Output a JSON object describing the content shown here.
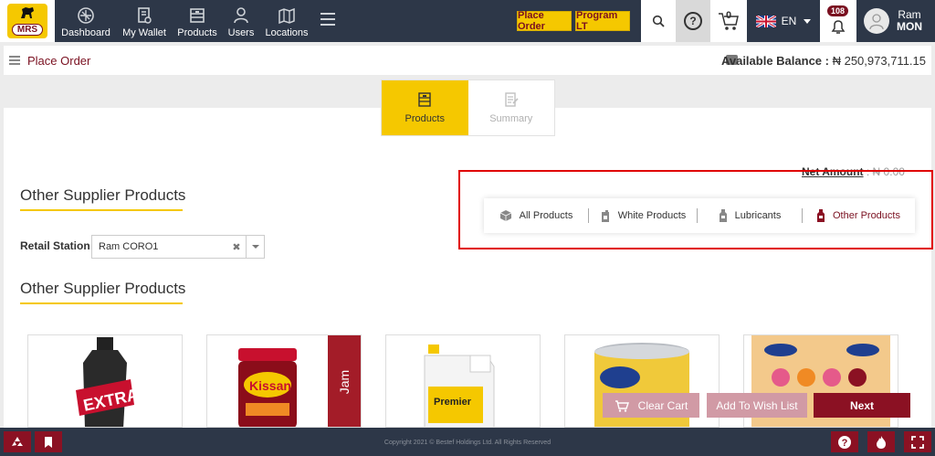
{
  "brand": {
    "logo_text": "MRS"
  },
  "nav": [
    {
      "label": "Dashboard",
      "icon": "dashboard-icon"
    },
    {
      "label": "My Wallet",
      "icon": "wallet-icon"
    },
    {
      "label": "Products",
      "icon": "products-icon"
    },
    {
      "label": "Users",
      "icon": "users-icon"
    },
    {
      "label": "Locations",
      "icon": "locations-icon"
    }
  ],
  "header": {
    "place_order": "Place Order",
    "program_lt": "Program LT",
    "cart_count": "0",
    "language": "EN",
    "notification_count": "108",
    "user_name": "Ram",
    "user_code": "MON"
  },
  "breadcrumb": {
    "title": "Place Order",
    "balance_label": "Available Balance :",
    "balance_value": "₦ 250,973,711.15"
  },
  "tabs": [
    {
      "label": "Products",
      "active": true
    },
    {
      "label": "Summary",
      "active": false
    }
  ],
  "filters": {
    "net_amount_label": "Net Amount",
    "net_amount_value": ": ₦ 0.00",
    "items": [
      {
        "label": "All Products",
        "selected": false
      },
      {
        "label": "White Products",
        "selected": false
      },
      {
        "label": "Lubricants",
        "selected": false
      },
      {
        "label": "Other Products",
        "selected": true
      }
    ]
  },
  "section": {
    "title_top": "Other Supplier Products",
    "title_bottom": "Other Supplier Products",
    "retail_label": "Retail Station",
    "retail_value": "Ram CORO1"
  },
  "products": [
    {
      "kind": "oil-bottle",
      "ribbon": ""
    },
    {
      "kind": "jam-jar",
      "ribbon": "Jam"
    },
    {
      "kind": "lubricant-jug",
      "ribbon": ""
    },
    {
      "kind": "formula-tin",
      "ribbon": ""
    },
    {
      "kind": "formula-box",
      "ribbon": ""
    }
  ],
  "actions": {
    "clear_cart": "Clear Cart",
    "wish_list": "Add To Wish List",
    "next": "Next"
  },
  "footer": {
    "copyright": "Copyright 2021 © Bestef Holdings Ltd. All Rights Reserved"
  },
  "colors": {
    "nav_bg": "#2d3748",
    "accent_yellow": "#f5c800",
    "brand_maroon": "#8b1123"
  }
}
